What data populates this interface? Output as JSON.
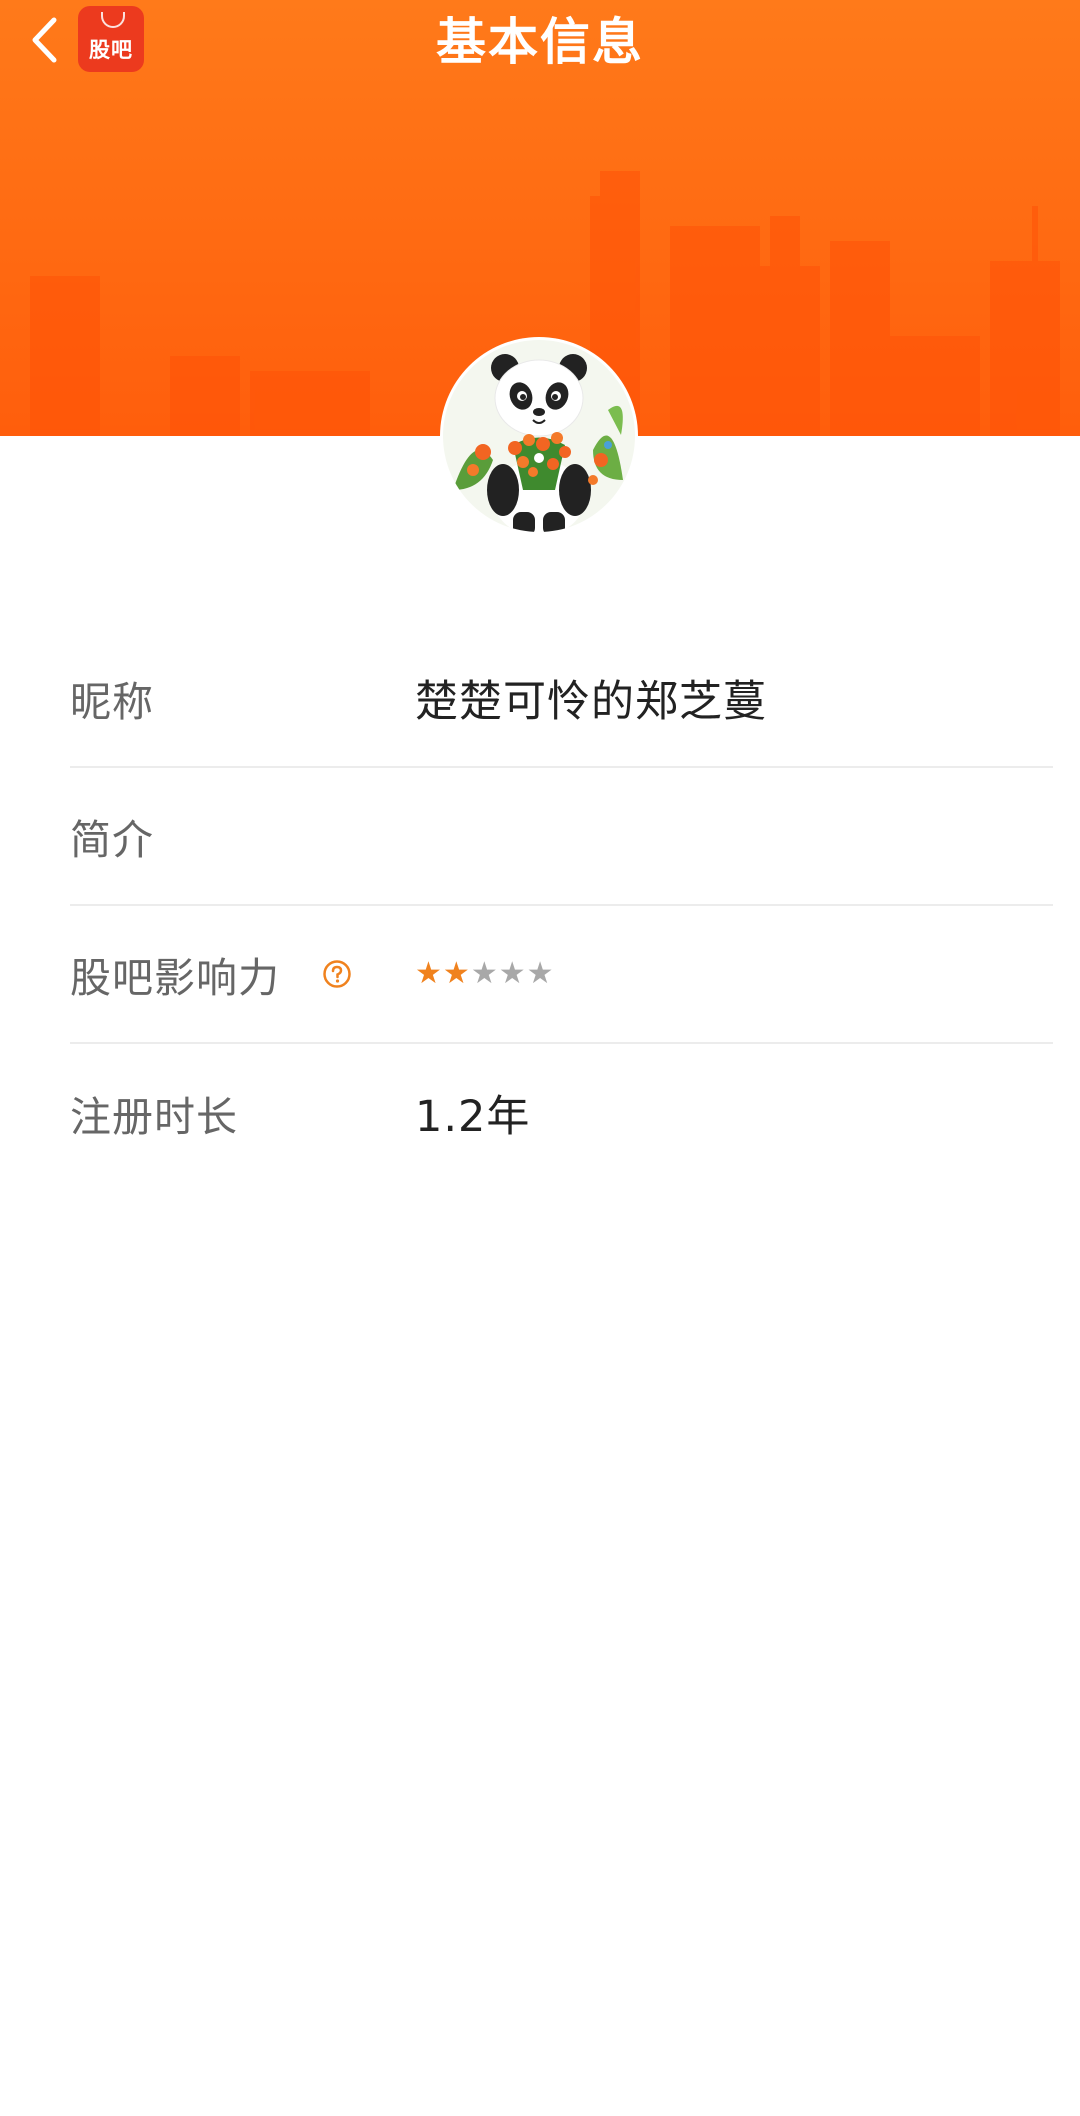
{
  "header": {
    "title": "基本信息",
    "app_badge_text": "股吧",
    "bg_color": "#ff6a12"
  },
  "profile": {
    "avatar_icon": "panda-with-flowers-avatar"
  },
  "fields": {
    "nickname": {
      "label": "昵称",
      "value": "楚楚可怜的郑芝蔓"
    },
    "bio": {
      "label": "简介",
      "value": ""
    },
    "influence": {
      "label": "股吧影响力",
      "help_icon": "question-circle-icon",
      "stars_filled": 2,
      "stars_total": 5,
      "star_on_color": "#f0821e",
      "star_off_color": "#a8a8a8"
    },
    "registration": {
      "label": "注册时长",
      "value": "1.2年"
    }
  }
}
